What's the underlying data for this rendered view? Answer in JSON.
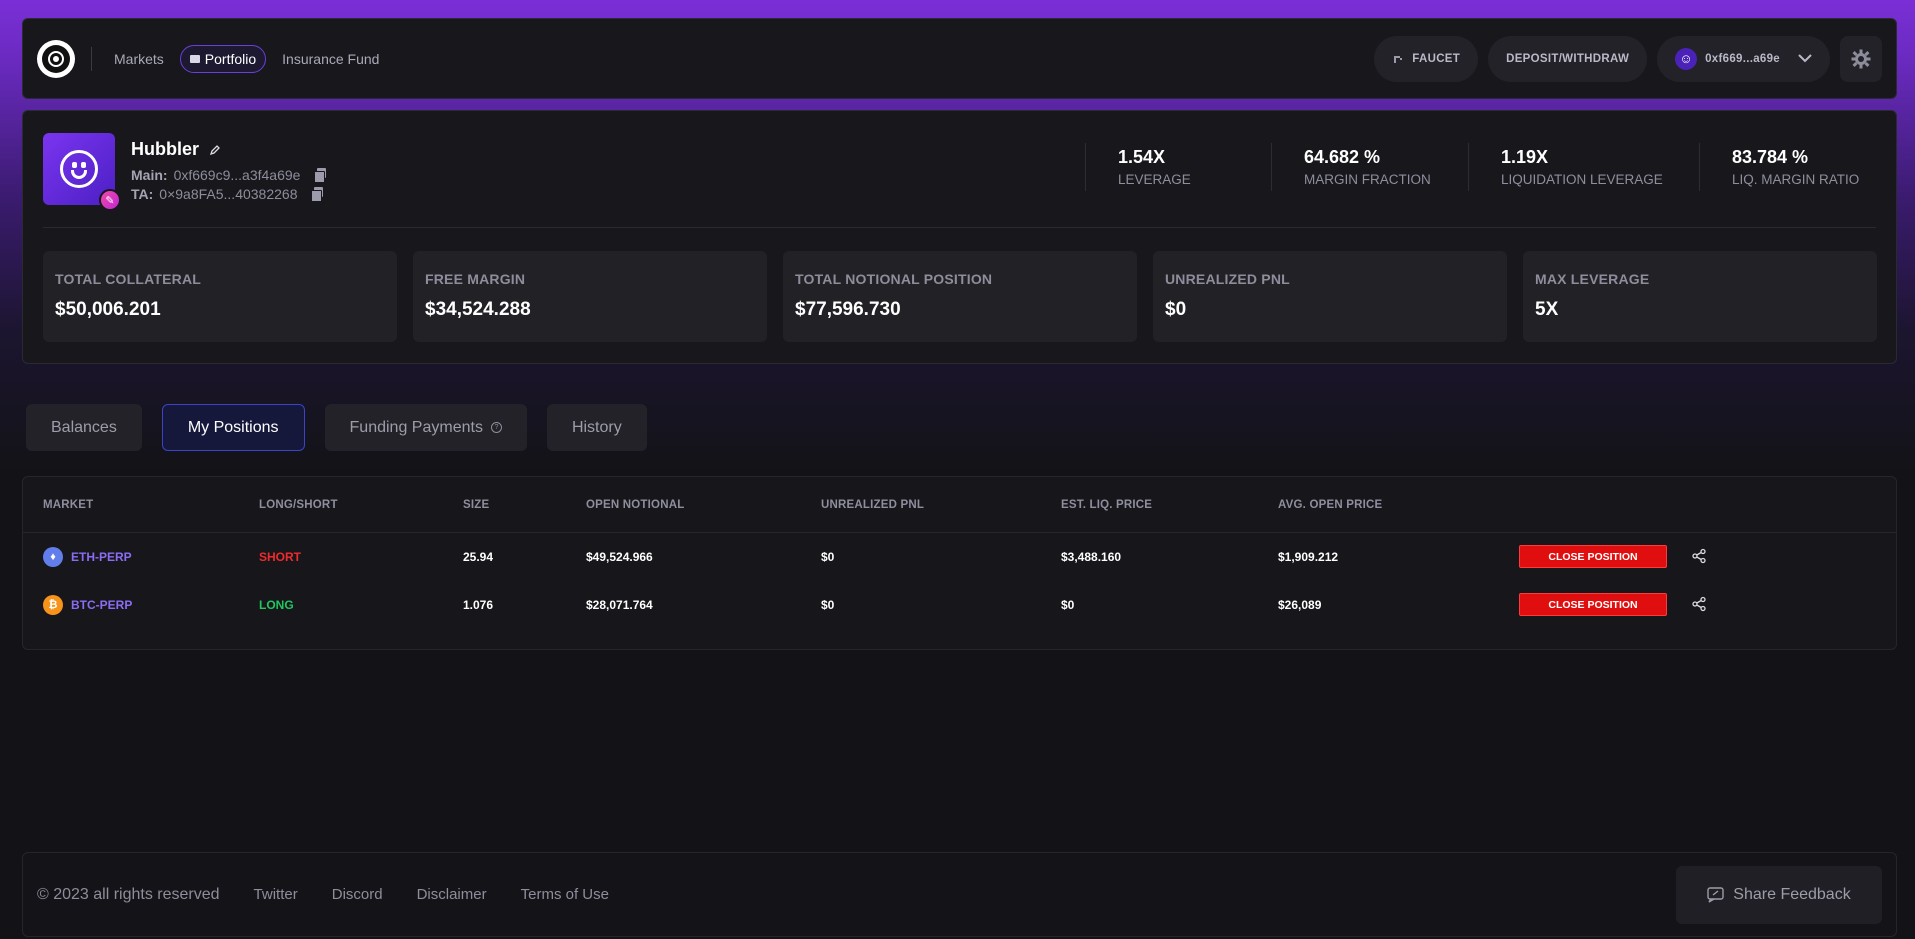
{
  "nav": {
    "links": [
      "Markets",
      "Portfolio",
      "Insurance Fund"
    ],
    "faucet": "FAUCET",
    "deposit": "DEPOSIT/WITHDRAW",
    "wallet": "0xf669...a69e"
  },
  "profile": {
    "name": "Hubbler",
    "main_label": "Main:",
    "main_addr": "0xf669c9...a3f4a69e",
    "ta_label": "TA:",
    "ta_addr": "0×9a8FA5...40382268",
    "stats": [
      {
        "value": "1.54X",
        "label": "LEVERAGE"
      },
      {
        "value": "64.682 %",
        "label": "MARGIN FRACTION"
      },
      {
        "value": "1.19X",
        "label": "LIQUIDATION LEVERAGE"
      },
      {
        "value": "83.784 %",
        "label": "LIQ. MARGIN RATIO"
      }
    ],
    "cards": [
      {
        "label": "TOTAL COLLATERAL",
        "value": "$50,006.201"
      },
      {
        "label": "FREE MARGIN",
        "value": "$34,524.288"
      },
      {
        "label": "TOTAL NOTIONAL POSITION",
        "value": "$77,596.730"
      },
      {
        "label": "UNREALIZED PNL",
        "value": "$0"
      },
      {
        "label": "MAX LEVERAGE",
        "value": "5X"
      }
    ]
  },
  "tabs": [
    "Balances",
    "My Positions",
    "Funding Payments",
    "History"
  ],
  "table": {
    "headers": [
      "MARKET",
      "LONG/SHORT",
      "SIZE",
      "OPEN NOTIONAL",
      "UNREALIZED PNL",
      "EST. LIQ. PRICE",
      "AVG. OPEN PRICE"
    ],
    "rows": [
      {
        "market": "ETH-PERP",
        "side": "SHORT",
        "size": "25.94",
        "notional": "$49,524.966",
        "pnl": "$0",
        "liq": "$3,488.160",
        "avg": "$1,909.212",
        "action": "CLOSE POSITION"
      },
      {
        "market": "BTC-PERP",
        "side": "LONG",
        "size": "1.076",
        "notional": "$28,071.764",
        "pnl": "$0",
        "liq": "$0",
        "avg": "$26,089",
        "action": "CLOSE POSITION"
      }
    ]
  },
  "footer": {
    "copyright": "© 2023 all rights reserved",
    "links": [
      "Twitter",
      "Discord",
      "Disclaimer",
      "Terms of Use"
    ],
    "feedback": "Share Feedback"
  }
}
